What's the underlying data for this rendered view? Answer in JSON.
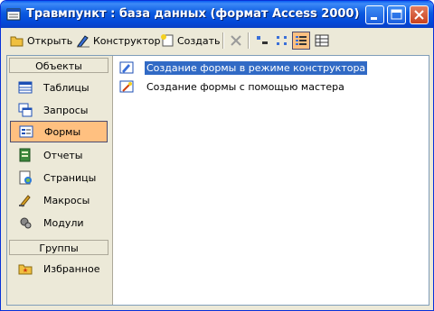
{
  "window": {
    "title": "Травмпункт : база данных (формат Access 2000)"
  },
  "toolbar": {
    "open_label": "Открыть",
    "design_label": "Конструктор",
    "create_label": "Создать"
  },
  "sidebar": {
    "objects_header": "Объекты",
    "items": [
      {
        "label": "Таблицы"
      },
      {
        "label": "Запросы"
      },
      {
        "label": "Формы"
      },
      {
        "label": "Отчеты"
      },
      {
        "label": "Страницы"
      },
      {
        "label": "Макросы"
      },
      {
        "label": "Модули"
      }
    ],
    "groups_header": "Группы",
    "favorites_label": "Избранное"
  },
  "main": {
    "items": [
      {
        "label": "Создание формы в режиме конструктора"
      },
      {
        "label": "Создание формы с помощью мастера"
      }
    ]
  },
  "colors": {
    "titlebar": "#0a5ff2",
    "selection_highlight": "#ffc080",
    "list_selection": "#316ac5"
  }
}
